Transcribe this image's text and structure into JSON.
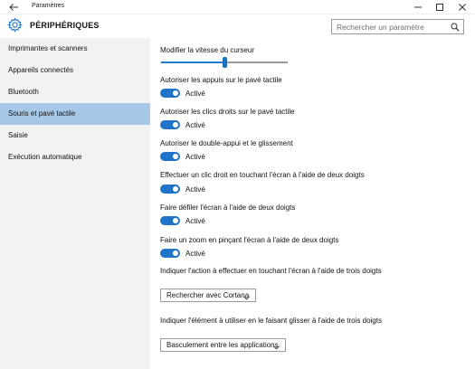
{
  "window": {
    "title": "Paramètres"
  },
  "header": {
    "page_title": "PÉRIPHÉRIQUES",
    "search_placeholder": "Rechercher un paramètre"
  },
  "sidebar": {
    "items": [
      {
        "label": "Imprimantes et scanners"
      },
      {
        "label": "Appareils connectés"
      },
      {
        "label": "Bluetooth"
      },
      {
        "label": "Souris et pavé tactile",
        "selected": true
      },
      {
        "label": "Saisie"
      },
      {
        "label": "Exécution automatique"
      }
    ]
  },
  "main": {
    "cursor_speed": {
      "label": "Modifier la vitesse du curseur",
      "level": 0.5
    },
    "toggles": [
      {
        "label": "Autoriser les appuis sur le pavé tactile",
        "state": "Activé",
        "on": true
      },
      {
        "label": "Autoriser les clics droits sur le pavé tactile",
        "state": "Activé",
        "on": true
      },
      {
        "label": "Autoriser le double-appui et le glissement",
        "state": "Activé",
        "on": true
      },
      {
        "label": "Effectuer un clic droit en touchant l'écran à l'aide de deux doigts",
        "state": "Activé",
        "on": true
      },
      {
        "label": "Faire défiler l'écran à l'aide de deux doigts",
        "state": "Activé",
        "on": true
      },
      {
        "label": "Faire un zoom en pinçant l'écran à l'aide de deux doigts",
        "state": "Activé",
        "on": true
      }
    ],
    "three_finger_tap": {
      "label": "Indiquer l'action à effectuer en touchant l'écran à l'aide de trois doigts",
      "value": "Rechercher avec Cortana"
    },
    "three_finger_swipe": {
      "label": "Indiquer l'élément à utiliser en le faisant glisser à l'aide de trois doigts",
      "value": "Basculement entre les applications"
    }
  },
  "colors": {
    "accent": "#1f73c8",
    "sidebar_bg": "#f2f2f2",
    "sidebar_selected": "#a8c8e8"
  }
}
